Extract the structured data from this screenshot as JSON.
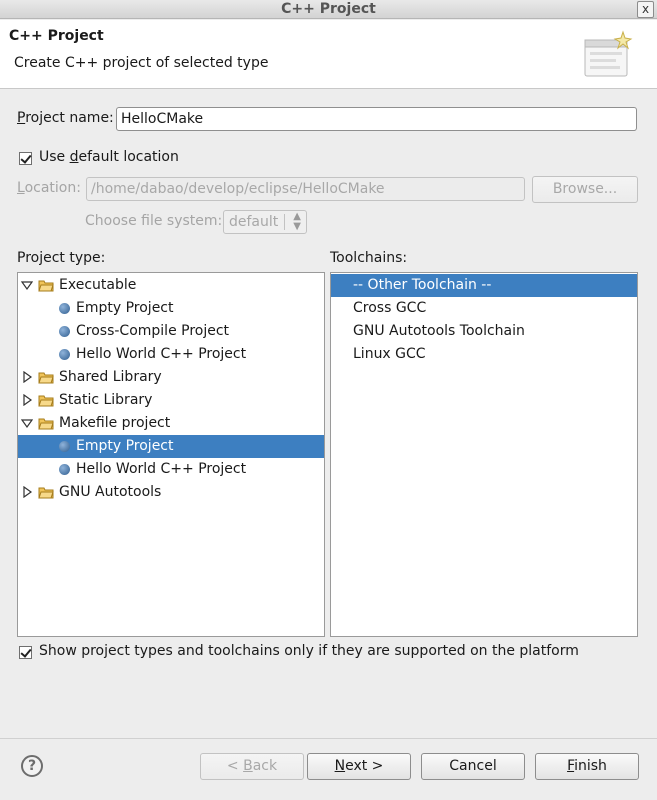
{
  "window": {
    "title": "C++ Project",
    "close_glyph": "x"
  },
  "header": {
    "title": "C++ Project",
    "description": "Create C++ project of selected type",
    "banner_icon": "new-project-wizard-icon"
  },
  "project_name": {
    "label_mnemonic": "P",
    "label_rest": "roject name:",
    "value": "HelloCMake"
  },
  "default_location": {
    "label_pre": "Use ",
    "label_mnemonic": "d",
    "label_post": "efault location",
    "checked": true
  },
  "location": {
    "label_mnemonic": "L",
    "label_rest": "ocation:",
    "value": "/home/dabao/develop/eclipse/HelloCMake",
    "browse_label": "Browse...",
    "enabled": false
  },
  "file_system": {
    "label": "Choose file system:",
    "value": "default",
    "enabled": false
  },
  "project_type": {
    "heading": "Project type:",
    "items": [
      {
        "label": "Executable",
        "kind": "folder",
        "expanded": true,
        "level": 0
      },
      {
        "label": "Empty Project",
        "kind": "leaf",
        "level": 1
      },
      {
        "label": "Cross-Compile Project",
        "kind": "leaf",
        "level": 1
      },
      {
        "label": "Hello World C++ Project",
        "kind": "leaf",
        "level": 1
      },
      {
        "label": "Shared Library",
        "kind": "folder",
        "expanded": false,
        "level": 0
      },
      {
        "label": "Static Library",
        "kind": "folder",
        "expanded": false,
        "level": 0
      },
      {
        "label": "Makefile project",
        "kind": "folder",
        "expanded": true,
        "level": 0
      },
      {
        "label": "Empty Project",
        "kind": "leaf",
        "level": 1,
        "selected": true
      },
      {
        "label": "Hello World C++ Project",
        "kind": "leaf",
        "level": 1
      },
      {
        "label": "GNU Autotools",
        "kind": "folder",
        "expanded": false,
        "level": 0
      }
    ]
  },
  "toolchains": {
    "heading": "Toolchains:",
    "items": [
      {
        "label": "-- Other Toolchain --",
        "selected": true
      },
      {
        "label": "Cross GCC"
      },
      {
        "label": "GNU Autotools Toolchain"
      },
      {
        "label": "Linux GCC"
      }
    ]
  },
  "supported_only": {
    "label": "Show project types and toolchains only if they are supported on the platform",
    "checked": true
  },
  "buttons": {
    "back": {
      "pre": "< ",
      "mnemonic": "B",
      "post": "ack",
      "enabled": false
    },
    "next": {
      "mnemonic": "N",
      "post": "ext >"
    },
    "cancel": {
      "label": "Cancel"
    },
    "finish": {
      "mnemonic": "F",
      "post": "inish"
    }
  },
  "help": {
    "glyph": "?"
  },
  "colors": {
    "selection": "#3d7fc1",
    "window_bg": "#ededed"
  }
}
